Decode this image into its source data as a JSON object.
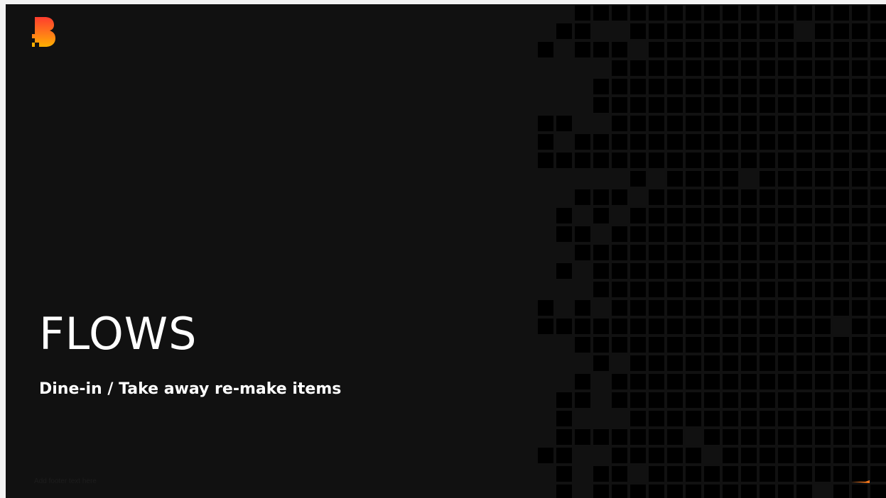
{
  "slide": {
    "title": "FLOWS",
    "subtitle": "Dine-in / Take away re-make items",
    "footer_note": "Add footer text here"
  },
  "logo": {
    "icon": "brand-b-logo-icon",
    "colors": [
      "#ff3d2e",
      "#ff7a1a",
      "#ffb000"
    ]
  },
  "decoration": {
    "icon": "pixel-gradient-mosaic",
    "colors": {
      "yellow": "#ffb01a",
      "orange": "#ff7a1a",
      "red": "#ff2a2f",
      "magenta": "#c3205e",
      "purple": "#6a2aa8"
    }
  },
  "theme": {
    "background": "#111111",
    "text": "#ffffff"
  }
}
